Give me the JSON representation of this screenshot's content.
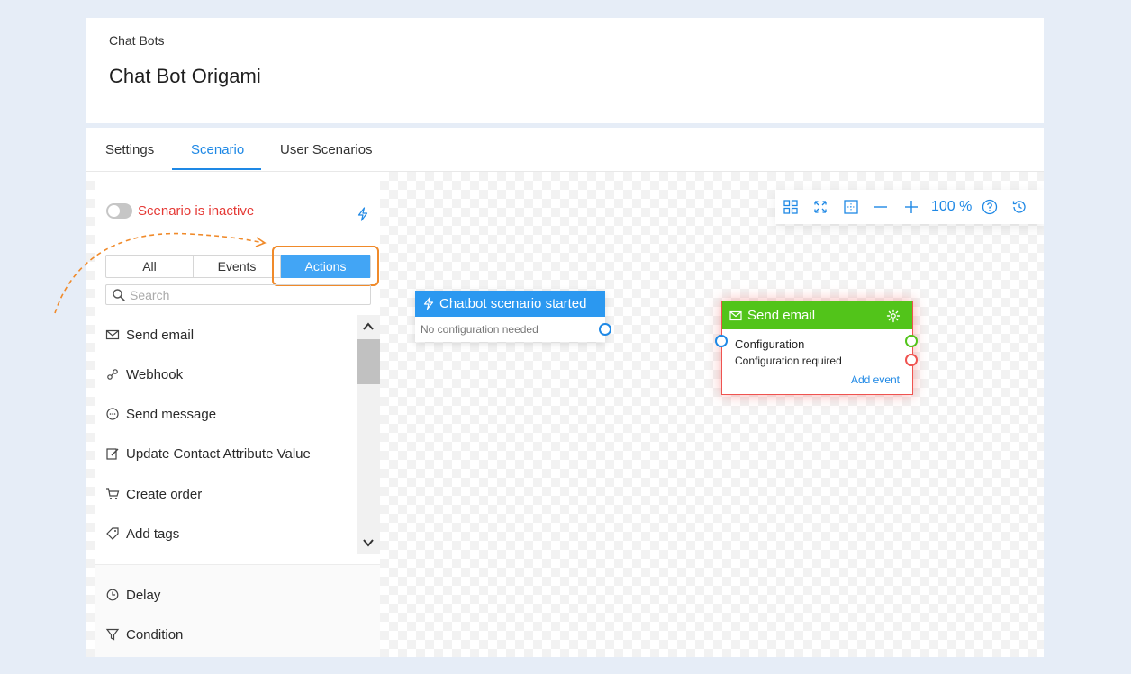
{
  "header": {
    "breadcrumb": "Chat Bots",
    "title": "Chat Bot Origami"
  },
  "tabs": [
    {
      "label": "Settings"
    },
    {
      "label": "Scenario",
      "active": true
    },
    {
      "label": "User Scenarios"
    }
  ],
  "sidebar": {
    "status_label": "Scenario is inactive",
    "filters": [
      "All",
      "Events",
      "Actions"
    ],
    "active_filter": "Actions",
    "search_placeholder": "Search",
    "actions": [
      {
        "label": "Send email",
        "icon": "mail-icon"
      },
      {
        "label": "Webhook",
        "icon": "webhook-icon"
      },
      {
        "label": "Send message",
        "icon": "message-icon"
      },
      {
        "label": "Update Contact Attribute Value",
        "icon": "edit-icon"
      },
      {
        "label": "Create order",
        "icon": "cart-icon"
      },
      {
        "label": "Add tags",
        "icon": "tag-icon"
      }
    ],
    "extra": [
      {
        "label": "Delay",
        "icon": "clock-icon"
      },
      {
        "label": "Condition",
        "icon": "filter-icon"
      }
    ]
  },
  "toolbar": {
    "zoom": "100 %"
  },
  "nodes": {
    "start": {
      "title": "Chatbot scenario started",
      "body": "No configuration needed"
    },
    "email": {
      "title": "Send email",
      "config_label": "Configuration",
      "config_status": "Configuration required",
      "add_event": "Add event"
    }
  },
  "colors": {
    "accent": "#1e88e5",
    "inactive": "#e53935",
    "start_node": "#2b98f0",
    "email_node": "#52c41a",
    "highlight": "#f08a2a"
  }
}
